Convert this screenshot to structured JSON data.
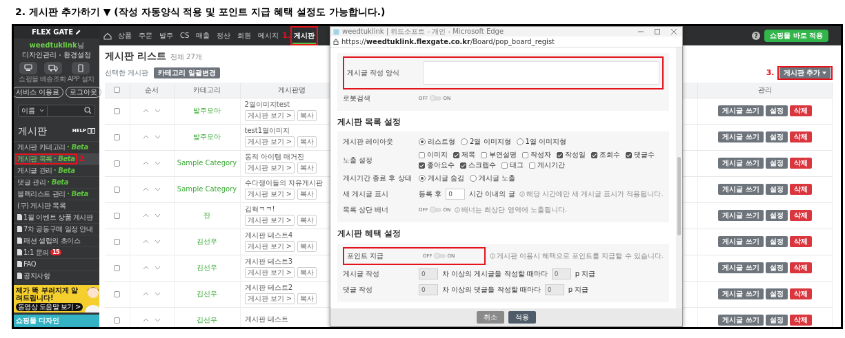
{
  "heading": "2. 게시판 추가하기 ▼ (작성 자동양식 적용 및 포인트 지급 혜택 설정도 가능합니다.)",
  "sidebar": {
    "logo": "FLEX GATE",
    "user_id": "weedtuklink",
    "user_suffix": "님",
    "links": [
      "디자인관리",
      "환경설정"
    ],
    "shortcuts": [
      {
        "label": "쇼핑몰",
        "kind": "monitor"
      },
      {
        "label": "배송조회",
        "kind": "truck"
      },
      {
        "label": "APP 설치",
        "kind": "phone"
      }
    ],
    "buttons": [
      "서비스 이용료",
      "로그아웃"
    ],
    "search": {
      "select": "이름"
    },
    "section_title": "게시판",
    "help": "HELP",
    "menu": [
      {
        "label": "게시판 카테고리",
        "kind": "link",
        "tag": "· Beta",
        "selected": false,
        "highlighted": false
      },
      {
        "label": "게시판 목록",
        "kind": "link",
        "tag": "· Beta",
        "selected": true,
        "highlighted": true,
        "marker": "2."
      },
      {
        "label": "게시글 관리",
        "kind": "link",
        "tag": "· Beta",
        "selected": false,
        "highlighted": false
      },
      {
        "label": "댓글 관리",
        "kind": "link",
        "tag": "· Beta",
        "selected": false,
        "highlighted": false
      },
      {
        "label": "블랙리스트 관리",
        "kind": "link",
        "tag": "· Beta",
        "selected": false,
        "highlighted": false
      },
      {
        "label": "(구) 게시판 목록",
        "kind": "link",
        "selected": false,
        "highlighted": false
      },
      {
        "label": "1월 이벤트 상품 게시판",
        "kind": "page",
        "selected": false,
        "highlighted": false
      },
      {
        "label": "7차 공동구매 일정 안내",
        "kind": "page",
        "selected": false,
        "highlighted": false
      },
      {
        "label": "패션 셀럽의 초이스",
        "kind": "page",
        "selected": false,
        "highlighted": false
      },
      {
        "label": "1:1 문의",
        "kind": "page",
        "count": "15",
        "selected": false,
        "highlighted": false
      },
      {
        "label": "FAQ",
        "kind": "page",
        "selected": false,
        "highlighted": false
      },
      {
        "label": "공지사항",
        "kind": "page",
        "selected": false,
        "highlighted": false
      }
    ],
    "banners": [
      {
        "title": "제가 똑 부러지게 알려드립니다!",
        "cta": "동영상 도움말 보기 >",
        "color": "#f5cf2e"
      },
      {
        "title": "쇼핑몰 디자인",
        "color": "#34b3c4"
      }
    ]
  },
  "nav": {
    "items": [
      {
        "label": "상품",
        "selected": false,
        "highlighted": false
      },
      {
        "label": "주문",
        "selected": false,
        "highlighted": false
      },
      {
        "label": "발주",
        "selected": false,
        "highlighted": false
      },
      {
        "label": "CS",
        "selected": false,
        "highlighted": false
      },
      {
        "label": "매출",
        "selected": false,
        "highlighted": false
      },
      {
        "label": "정산",
        "selected": false,
        "highlighted": false
      },
      {
        "label": "회원",
        "selected": false,
        "highlighted": false
      },
      {
        "label": "메시지",
        "selected": false,
        "highlighted": false
      },
      {
        "label": "게시판",
        "selected": true,
        "highlighted": true,
        "marker": "1."
      }
    ],
    "help": "?",
    "apply_button": "쇼핑몰 바로 적용"
  },
  "board_list": {
    "title": "게시판 리스트",
    "total": "전체 27개",
    "selected_label": "선택한 게시판",
    "bulk_button": "카테고리 일괄변경",
    "add_button": {
      "label": "게시판 추가",
      "highlighted": true,
      "marker": "3."
    },
    "columns": [
      "순서",
      "카테고리",
      "게시판명",
      "관리"
    ],
    "all_checked": false,
    "rows": [
      {
        "checked": false,
        "category": "발주모아",
        "name": "2열이미지test",
        "view_button": "게시판 보기 >",
        "copy_button": "복사",
        "actions": [
          {
            "label": "게시글 쓰기",
            "kind": "secondary"
          },
          {
            "label": "설정",
            "kind": "secondary"
          },
          {
            "label": "삭제",
            "kind": "danger"
          }
        ]
      },
      {
        "checked": false,
        "category": "발주모아",
        "name": "test1열이미지",
        "view_button": "게시판 보기 >",
        "copy_button": "복사",
        "actions": [
          {
            "label": "게시글 쓰기",
            "kind": "secondary"
          },
          {
            "label": "설정",
            "kind": "secondary"
          },
          {
            "label": "삭제",
            "kind": "danger"
          }
        ]
      },
      {
        "checked": false,
        "category": "Sample Category",
        "name": "동적 아이템 매거진",
        "view_button": "게시판 보기 >",
        "copy_button": "복사",
        "actions": [
          {
            "label": "게시글 쓰기",
            "kind": "secondary"
          },
          {
            "label": "설정",
            "kind": "secondary"
          },
          {
            "label": "삭제",
            "kind": "danger"
          }
        ]
      },
      {
        "checked": false,
        "category": "Sample Category",
        "name": "수다쟁이들의 자유게시판",
        "view_button": "게시판 보기 >",
        "copy_button": "복사",
        "actions": [
          {
            "label": "게시글 쓰기",
            "kind": "secondary"
          },
          {
            "label": "설정",
            "kind": "secondary"
          },
          {
            "label": "삭제",
            "kind": "danger"
          }
        ]
      },
      {
        "checked": false,
        "category": "잔",
        "name": "김혁ㅋㅋ!",
        "view_button": "게시판 보기 >",
        "copy_button": "복사",
        "actions": [
          {
            "label": "게시글 쓰기",
            "kind": "secondary"
          },
          {
            "label": "설정",
            "kind": "secondary"
          },
          {
            "label": "삭제",
            "kind": "danger"
          }
        ]
      },
      {
        "checked": false,
        "category": "김선우",
        "name": "게시판 테스트4",
        "view_button": "게시판 보기 >",
        "copy_button": "복사",
        "actions": [
          {
            "label": "게시글 쓰기",
            "kind": "secondary"
          },
          {
            "label": "설정",
            "kind": "secondary"
          },
          {
            "label": "삭제",
            "kind": "danger"
          }
        ]
      },
      {
        "checked": false,
        "category": "김선우",
        "name": "게시판 테스트3",
        "view_button": "게시판 보기 >",
        "copy_button": "복사",
        "actions": [
          {
            "label": "게시글 쓰기",
            "kind": "secondary"
          },
          {
            "label": "설정",
            "kind": "secondary"
          },
          {
            "label": "삭제",
            "kind": "danger"
          }
        ]
      },
      {
        "checked": false,
        "category": "김선우",
        "name": "게시판 테스트2",
        "view_button": "게시판 보기 >",
        "copy_button": "복사",
        "actions": [
          {
            "label": "게시글 쓰기",
            "kind": "secondary"
          },
          {
            "label": "설정",
            "kind": "secondary"
          },
          {
            "label": "삭제",
            "kind": "danger"
          }
        ]
      },
      {
        "checked": false,
        "category": "김선우",
        "name": "게시판 테스트",
        "actions": [
          {
            "label": "게시글 쓰기",
            "kind": "secondary"
          },
          {
            "label": "설정",
            "kind": "secondary"
          },
          {
            "label": "삭제",
            "kind": "danger"
          }
        ]
      }
    ]
  },
  "popup": {
    "title": "weedtuklink | 위드소프트 - 개인 - Microsoft Edge",
    "url": "https://**weedtuklink.flexgate.co.kr**/Board/pop_board_regist",
    "sections": [
      {
        "rows": [
          {
            "kind": "textarea",
            "label": "게시글 작성 양식",
            "highlighted": true
          },
          {
            "kind": "toggle",
            "label": "로봇검색",
            "off_label": "OFF",
            "on_label": "ON",
            "on": false
          }
        ]
      },
      {
        "title": "게시판 목록 설정",
        "rows": [
          {
            "kind": "radio",
            "label": "게시판 레이아웃",
            "options": [
              {
                "label": "리스트형",
                "selected": true
              },
              {
                "label": "2열 이미지형",
                "selected": false
              },
              {
                "label": "1열 이미지형",
                "selected": false
              }
            ]
          },
          {
            "kind": "checkboxes",
            "label": "노출 설정",
            "options": [
              {
                "label": "이미지",
                "checked": false
              },
              {
                "label": "제목",
                "checked": true
              },
              {
                "label": "부연설명",
                "checked": false
              },
              {
                "label": "작성자",
                "checked": false
              },
              {
                "label": "작성일",
                "checked": true
              },
              {
                "label": "조회수",
                "checked": true
              },
              {
                "label": "댓글수",
                "checked": true
              },
              {
                "label": "좋아요수",
                "checked": true
              },
              {
                "label": "스크랩수",
                "checked": true
              },
              {
                "label": "태그",
                "checked": false
              },
              {
                "label": "게시기간",
                "checked": false
              }
            ]
          },
          {
            "kind": "radio",
            "label": "게시기간 종료 후 상태",
            "options": [
              {
                "label": "게시글 숨김",
                "selected": true
              },
              {
                "label": "게시글 노출",
                "selected": false
              }
            ]
          },
          {
            "kind": "number",
            "label": "새 게시글 표시",
            "prefix": "등록 후",
            "value": "0",
            "suffix": "시간 이내의 글",
            "hint": "해당 시간에만 새 게시글 표시가 적용됩니다."
          },
          {
            "kind": "toggle",
            "label": "목록 상단 배너",
            "off_label": "OFF",
            "on_label": "ON",
            "on": false,
            "hint": "배너는 최상단 영역에 노출됩니다."
          }
        ]
      },
      {
        "title": "게시판 혜택 설정",
        "rows": [
          {
            "kind": "toggle",
            "label": "포인트 지급",
            "off_label": "OFF",
            "on_label": "ON",
            "on": false,
            "highlighted": true,
            "hint": "게시판 이용시 혜택으로 포인트를 지급할 수 있습니다."
          },
          {
            "kind": "points",
            "label": "게시글 작성",
            "value": "0",
            "middle": "차 이상의 게시글을 작성할 때마다",
            "points": "0",
            "suffix": "p 지급",
            "disabled": true
          },
          {
            "kind": "points",
            "label": "댓글 작성",
            "value": "0",
            "middle": "차 이상의 댓글을 작성할 때마다",
            "points": "0",
            "suffix": "p 지급",
            "disabled": true
          }
        ]
      }
    ],
    "footer": [
      {
        "label": "취소",
        "kind": "secondary"
      },
      {
        "label": "적용",
        "kind": "primary"
      }
    ]
  }
}
